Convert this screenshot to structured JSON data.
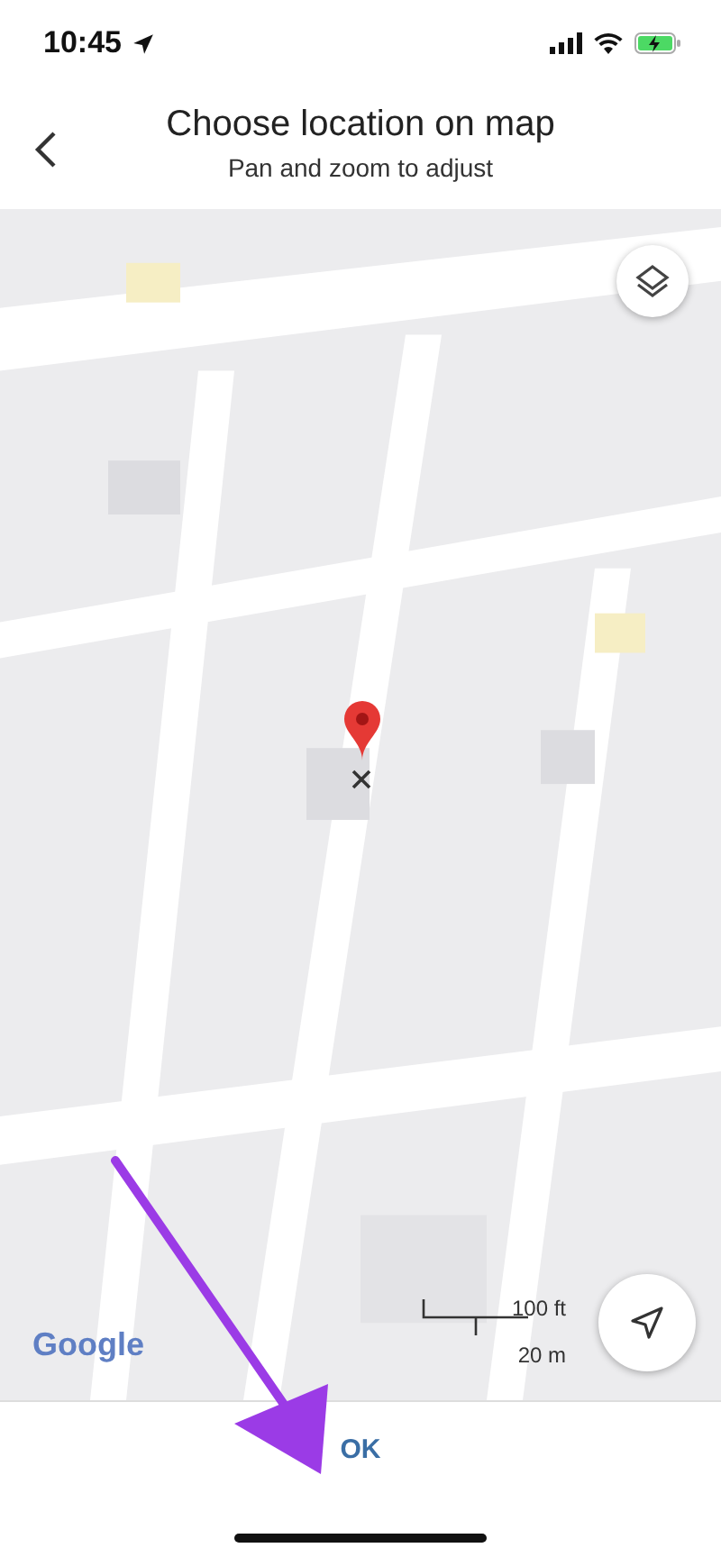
{
  "status_bar": {
    "time": "10:45"
  },
  "header": {
    "title": "Choose location on map",
    "subtitle": "Pan and zoom to adjust"
  },
  "map": {
    "logo": "Google",
    "scale": {
      "imperial": "100 ft",
      "metric": "20 m"
    }
  },
  "footer": {
    "button": "OK"
  }
}
